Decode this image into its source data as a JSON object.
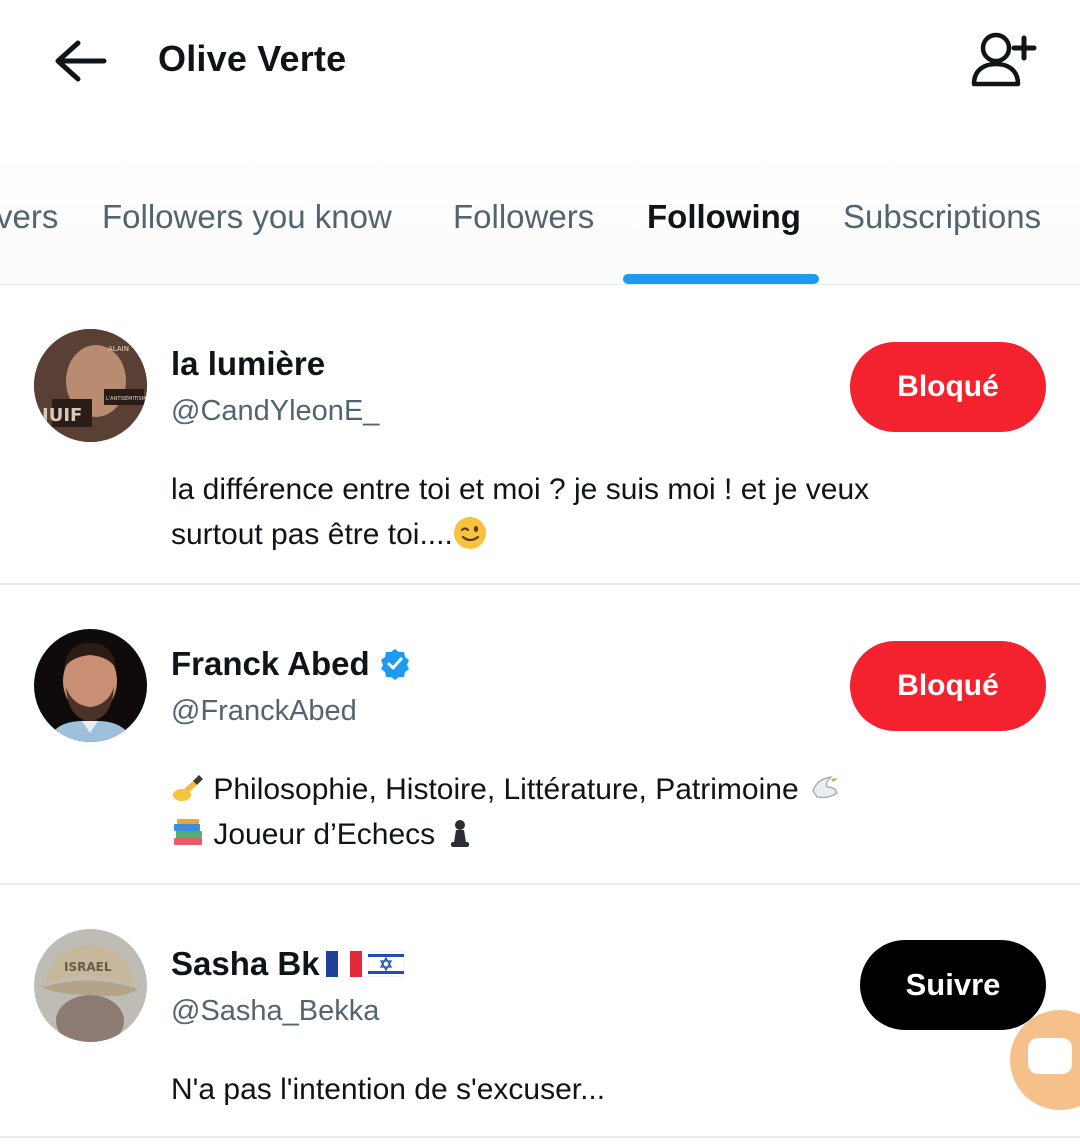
{
  "header": {
    "title": "Olive Verte",
    "back_icon": "arrow-left-icon",
    "add_user_icon": "person-add-icon"
  },
  "tabs": [
    {
      "label": "Verified Followers",
      "visible_text": "vers"
    },
    {
      "label": "Followers you know"
    },
    {
      "label": "Followers"
    },
    {
      "label": "Following",
      "active": true
    },
    {
      "label": "Subscriptions"
    }
  ],
  "users": [
    {
      "name": "la lumière",
      "handle": "@CandYleonE_",
      "bio_line1": "la différence entre toi et moi ? je suis moi ! et je veux",
      "bio_line2": "surtout pas être toi....",
      "bio_emoji": "winking-face-emoji",
      "button": "Bloqué",
      "button_color": "#f4212e"
    },
    {
      "name": "Franck Abed",
      "verified": true,
      "handle": "@FranckAbed",
      "bio_line1": "Philosophie, Histoire, Littérature, Patrimoine",
      "bio_line2": "Joueur d’Echecs",
      "bio_emojis": [
        "writing-hand-emoji",
        "dove-emoji",
        "books-emoji",
        "chess-pawn-emoji"
      ],
      "button": "Bloqué",
      "button_color": "#f4212e"
    },
    {
      "name": "Sasha Bk",
      "flags": [
        "flag-france-icon",
        "flag-israel-icon"
      ],
      "handle": "@Sasha_Bekka",
      "bio_line1": "N'a pas l'intention de s'excuser...",
      "button": "Suivre",
      "button_color": "#000000"
    }
  ],
  "colors": {
    "accent": "#1d9bf0",
    "blocked": "#f4212e",
    "text_primary": "#0f1419",
    "text_secondary": "#536471"
  }
}
